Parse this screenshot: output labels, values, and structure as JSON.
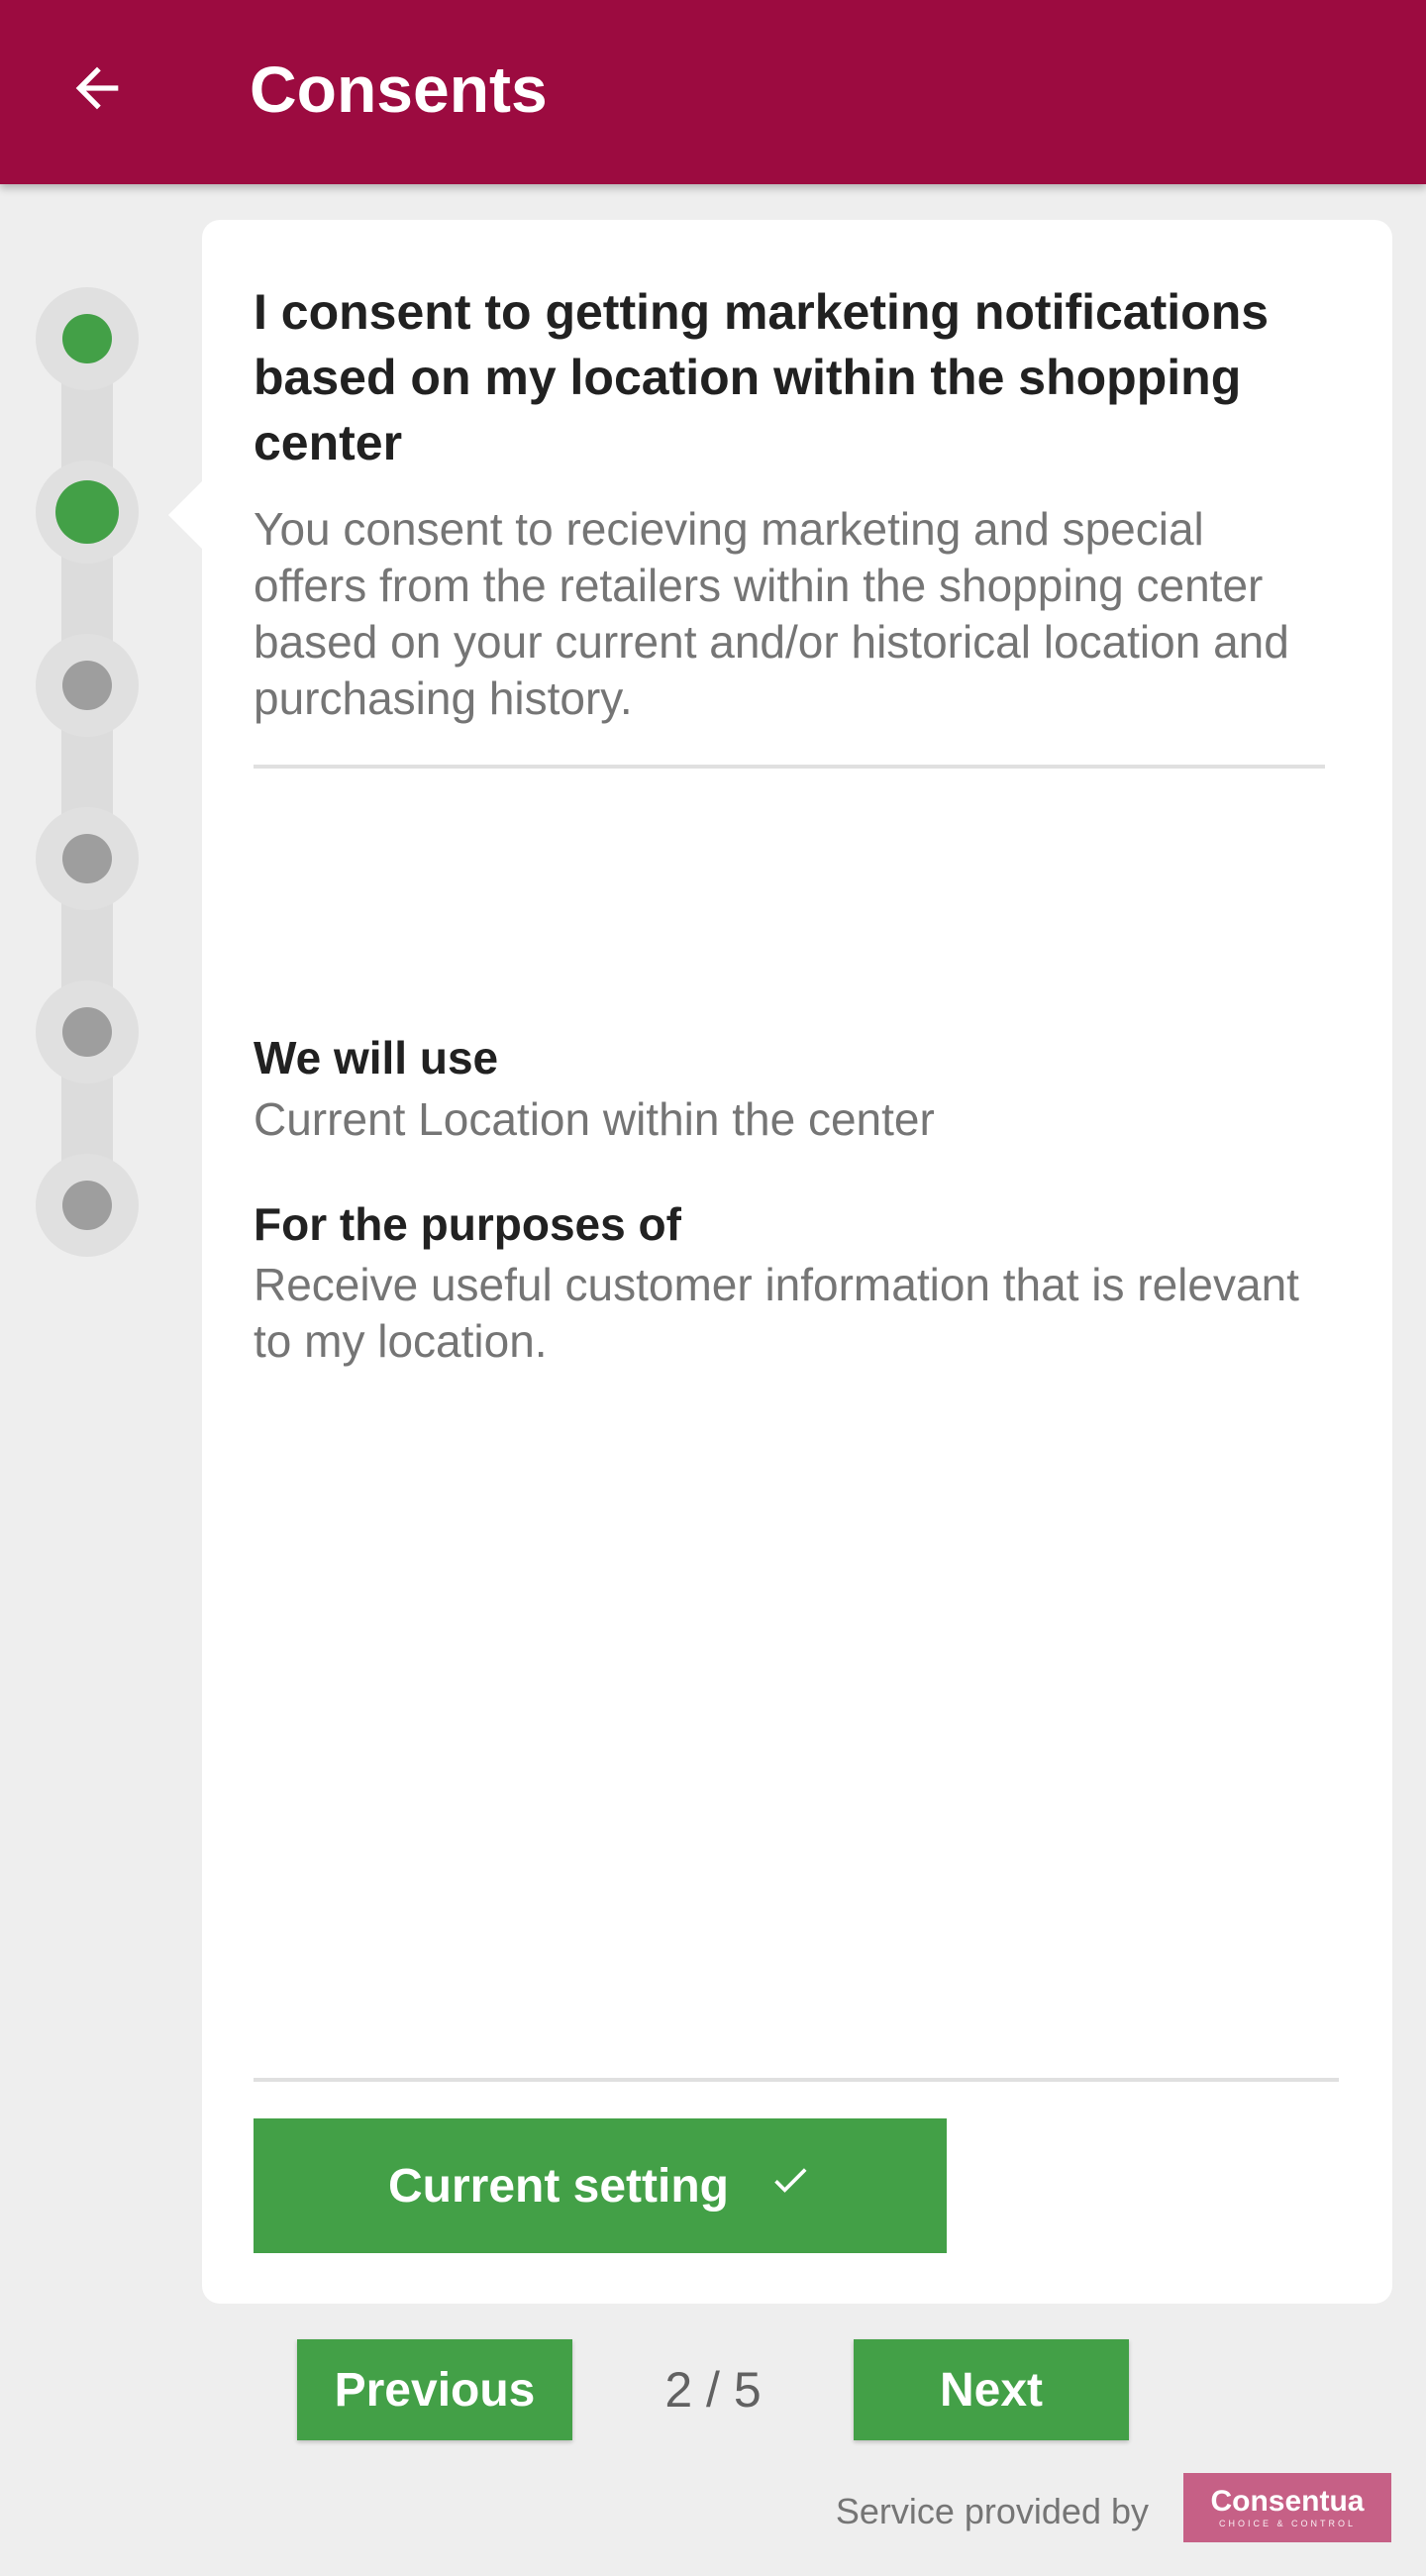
{
  "app_bar": {
    "title": "Consents",
    "background_color": "#9c0b40",
    "back_icon": "arrow-left-icon"
  },
  "stepper": {
    "steps": [
      {
        "state": "done"
      },
      {
        "state": "active"
      },
      {
        "state": "pending"
      },
      {
        "state": "pending"
      },
      {
        "state": "pending"
      },
      {
        "state": "pending"
      }
    ],
    "done_color": "#43a047",
    "pending_color": "#9e9e9e"
  },
  "consent": {
    "title": "I consent to getting marketing notifications based on my location within the shopping center",
    "description": "You consent to recieving marketing and special offers from the retailers within the shopping center based on your current and/or historical location and purchasing history.",
    "we_will_use_heading": "We will use",
    "we_will_use_value": "Current Location within the center",
    "purposes_heading": "For the purposes of",
    "purposes_value": "Receive useful customer information that is relevant to my location.",
    "setting_button_label": "Current setting",
    "setting_button_icon": "check-icon"
  },
  "pager": {
    "previous_label": "Previous",
    "next_label": "Next",
    "indicator": "2 / 5",
    "button_color": "#43a047"
  },
  "footer": {
    "provided_by": "Service provided by",
    "brand_name": "Consentua",
    "brand_tagline": "CHOICE & CONTROL",
    "brand_color": "#c66086"
  }
}
